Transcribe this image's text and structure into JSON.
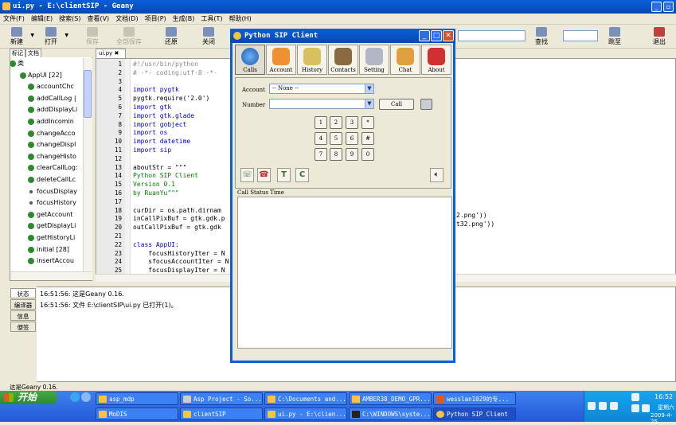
{
  "geany": {
    "title": "ui.py - E:\\clientSIP - Geany",
    "menu": [
      "文件(F)",
      "编辑(E)",
      "搜索(S)",
      "查看(V)",
      "文档(D)",
      "项目(P)",
      "生成(B)",
      "工具(T)",
      "帮助(H)"
    ],
    "toolbar": {
      "new": "新建",
      "open": "打开",
      "save": "保存",
      "save_all": "全部保存",
      "revert": "还原",
      "close": "关闭",
      "find": "查找",
      "goto": "跳至",
      "quit": "退出"
    },
    "sidebar_tabs": [
      "标记",
      "文档"
    ],
    "sidebar_items": [
      {
        "label": "类",
        "level": 0
      },
      {
        "label": "AppUI [22]",
        "level": 1
      },
      {
        "label": "accountChc",
        "level": 2
      },
      {
        "label": "addCallLog |",
        "level": 2
      },
      {
        "label": "addDisplayLi",
        "level": 2
      },
      {
        "label": "addIncomin",
        "level": 2
      },
      {
        "label": "changeAcco",
        "level": 2
      },
      {
        "label": "changeDispl",
        "level": 2
      },
      {
        "label": "changeHisto",
        "level": 2
      },
      {
        "label": "clearCallLog:",
        "level": 2
      },
      {
        "label": "deleteCallLc",
        "level": 2
      },
      {
        "label": "focusDisplay",
        "level": 2,
        "dot": true
      },
      {
        "label": "focusHistory",
        "level": 2,
        "dot": true
      },
      {
        "label": "getAccount",
        "level": 2
      },
      {
        "label": "getDisplayLi",
        "level": 2
      },
      {
        "label": "getHistoryLi",
        "level": 2
      },
      {
        "label": "initial [28]",
        "level": 2
      },
      {
        "label": "insertAccou",
        "level": 2
      }
    ],
    "editor_tab": "ui.py",
    "code_lines": [
      {
        "n": "1",
        "t": "#!/usr/bin/python",
        "c": "cm"
      },
      {
        "n": "2",
        "t": "# -*- coding:utf-8 -*-",
        "c": "cm"
      },
      {
        "n": "3",
        "t": "",
        "c": ""
      },
      {
        "n": "4",
        "t": "import pygtk",
        "c": "kw"
      },
      {
        "n": "5",
        "t": "pygtk.require('2.0')",
        "c": ""
      },
      {
        "n": "6",
        "t": "import gtk",
        "c": "kw"
      },
      {
        "n": "7",
        "t": "import gtk.glade",
        "c": "kw"
      },
      {
        "n": "8",
        "t": "import gobject",
        "c": "kw"
      },
      {
        "n": "9",
        "t": "import os",
        "c": "kw"
      },
      {
        "n": "10",
        "t": "import datetime",
        "c": "kw"
      },
      {
        "n": "11",
        "t": "import sip",
        "c": "kw"
      },
      {
        "n": "12",
        "t": "",
        "c": ""
      },
      {
        "n": "13",
        "t": "aboutStr = \"\"\"",
        "c": ""
      },
      {
        "n": "14",
        "t": "Python SIP Client",
        "c": "str"
      },
      {
        "n": "15",
        "t": "Version 0.1",
        "c": "str"
      },
      {
        "n": "16",
        "t": "by RuanYu\"\"\"",
        "c": "str"
      },
      {
        "n": "17",
        "t": "",
        "c": ""
      },
      {
        "n": "18",
        "t": "curDir = os.path.dirnam",
        "c": ""
      },
      {
        "n": "19",
        "t": "inCallPixBuf = gtk.gdk.p",
        "c": ""
      },
      {
        "n": "20",
        "t": "outCallPixBuf = gtk.gdk",
        "c": ""
      },
      {
        "n": "21",
        "t": "",
        "c": ""
      },
      {
        "n": "22",
        "t": "class AppUI:",
        "c": "kw"
      },
      {
        "n": "23",
        "t": "    focusHistoryIter = N",
        "c": ""
      },
      {
        "n": "24",
        "t": "    sfocusAccountIter = N",
        "c": ""
      },
      {
        "n": "25",
        "t": "    focusDisplayIter = N",
        "c": ""
      }
    ],
    "code_right_19": "2.png'))",
    "code_right_20": "t32.png'))",
    "msg_tabs": [
      "状态",
      "编译器",
      "信息",
      "便签"
    ],
    "msg_lines": [
      "16:51:56: 这是Geany 0.16.",
      "16:51:56: 文件 E:\\clientSIP\\ui.py 已打开(1)。"
    ],
    "status": "这是Geany 0.16."
  },
  "sip": {
    "title": "Python SIP Client",
    "nav": [
      "Calls",
      "Account",
      "History",
      "Contacts",
      "Setting",
      "Chat",
      "About"
    ],
    "account_label": "Account",
    "account_value": "-- None --",
    "number_label": "Number",
    "number_value": "",
    "call_button": "Call",
    "keypad": [
      "1",
      "2",
      "3",
      "*",
      "4",
      "5",
      "6",
      "#",
      "7",
      "8",
      "9",
      "0"
    ],
    "action_t": "T",
    "action_c": "C",
    "status_header": "Call Status Time"
  },
  "taskbar": {
    "start": "开始",
    "tasks_row1": [
      "asp_mdp",
      "Asp Project - So...",
      "C:\\Documents and...",
      "AMBER38_DEMO_GPR...",
      "wesslan1029的专..."
    ],
    "tasks_row2": [
      "MoDIS",
      "clientSIP",
      "ui.py - E:\\clien...",
      "C:\\WINDOWS\\syste...",
      "Python SIP Client"
    ],
    "time": "16:52",
    "day": "星期六",
    "date": "2009-4-25"
  }
}
